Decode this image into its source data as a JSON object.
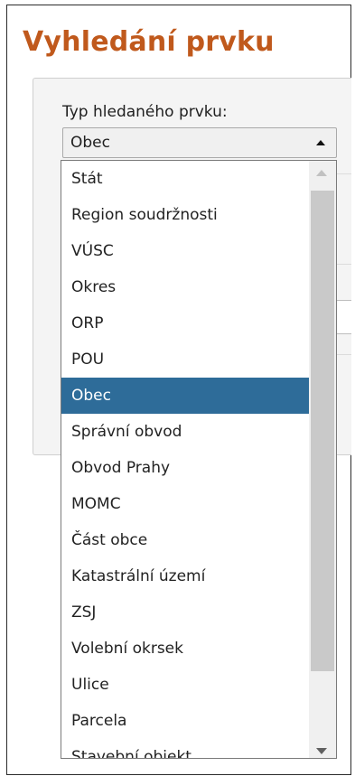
{
  "page": {
    "title": "Vyhledání prvku"
  },
  "form": {
    "type_label": "Typ hledaného prvku:",
    "selected_value": "Obec"
  },
  "dropdown": {
    "options": [
      "Stát",
      "Region soudržnosti",
      "VÚSC",
      "Okres",
      "ORP",
      "POU",
      "Obec",
      "Správní obvod",
      "Obvod Prahy",
      "MOMC",
      "Část obce",
      "Katastrální území",
      "ZSJ",
      "Volební okrsek",
      "Ulice",
      "Parcela",
      "Stavební objekt"
    ],
    "highlighted_index": 6
  },
  "colors": {
    "title": "#c0591c",
    "highlight": "#2e6c99"
  }
}
